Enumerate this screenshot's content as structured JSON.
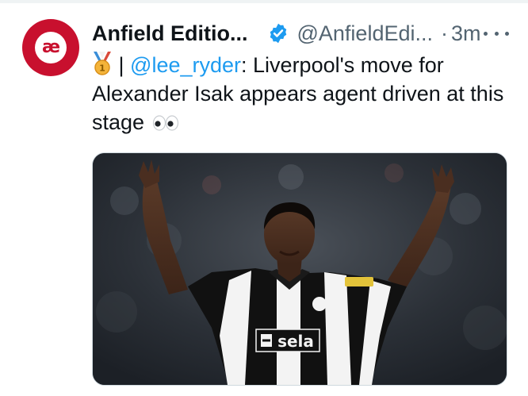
{
  "author": {
    "display_name": "Anfield Editio...",
    "handle": "@AnfieldEdi...",
    "separator": "·",
    "timestamp": "3m",
    "avatar_text": "æ",
    "brand_color": "#c8102e"
  },
  "tweet": {
    "prefix_separator": "|",
    "mention": "@lee_ryder",
    "text": ": Liverpool's move for Alexander Isak appears agent driven at this stage",
    "mention_color": "#1d9bf0"
  },
  "media": {
    "shirt_sponsor": "sela",
    "type": "photo"
  },
  "icons": {
    "verified": "verified-badge-icon",
    "more": "more-horizontal-icon",
    "medal": "medal-emoji-icon",
    "eyes": "eyes-emoji-icon"
  }
}
